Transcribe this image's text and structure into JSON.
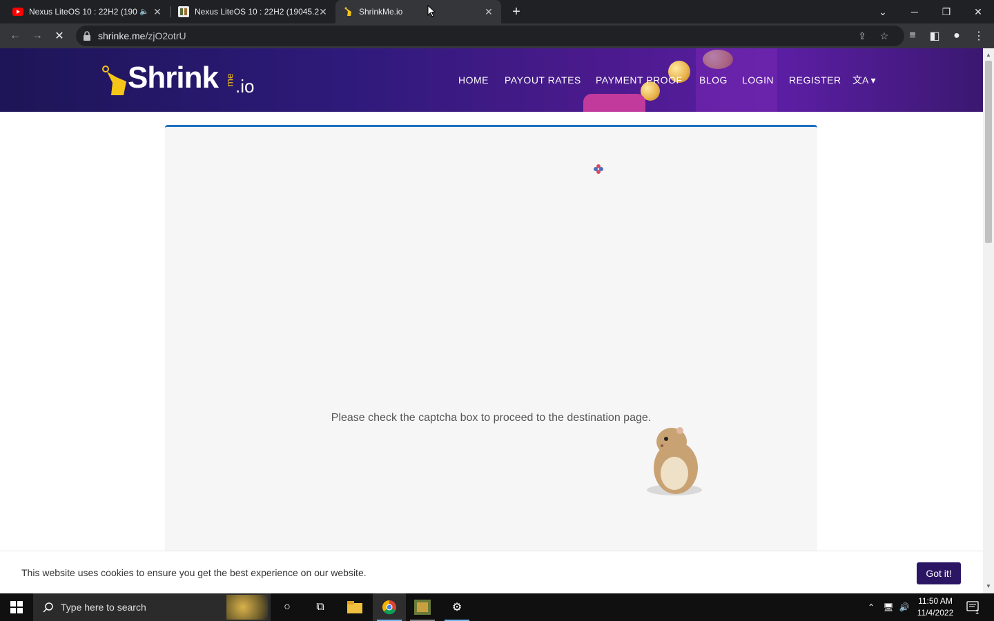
{
  "browser": {
    "tabs": [
      {
        "title": "Nexus LiteOS 10 : 22H2 (190",
        "favicon": "youtube-icon",
        "muted_icon": "speaker-muted-icon"
      },
      {
        "title": "Nexus LiteOS 10 : 22H2 (19045.2",
        "favicon": "site-icon"
      },
      {
        "title": "ShrinkMe.io",
        "favicon": "shrinkme-icon",
        "active": true
      }
    ],
    "url_domain": "shrinke.me",
    "url_path": "/zjO2otrU"
  },
  "site": {
    "logo_text": "Shrink",
    "logo_me": "me",
    "logo_io": ".io",
    "nav": [
      "HOME",
      "PAYOUT RATES",
      "PAYMENT PROOF",
      "BLOG",
      "LOGIN",
      "REGISTER"
    ],
    "language_icon": "translate-icon",
    "accent_color": "#1f6fc1",
    "header_color": "#2e1a7a"
  },
  "main": {
    "captcha_message": "Please check the captcha box to proceed to the destination page."
  },
  "cookie": {
    "text": "This website uses cookies to ensure you get the best experience on our website.",
    "button": "Got it!",
    "button_color": "#2b1664"
  },
  "taskbar": {
    "search_placeholder": "Type here to search",
    "time": "11:50 AM",
    "date": "11/4/2022",
    "notification_count": "1"
  }
}
